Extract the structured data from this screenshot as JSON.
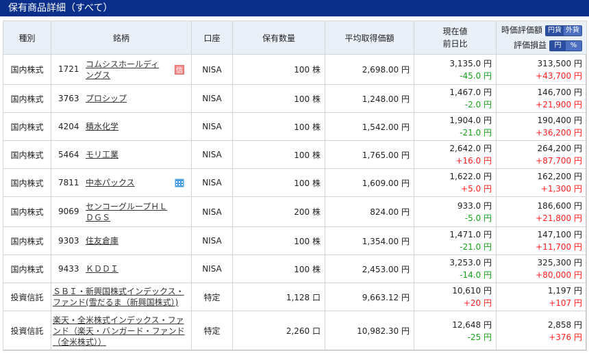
{
  "title": "保有商品詳細（すべて）",
  "headers": {
    "type": "種別",
    "name": "銘柄",
    "account": "口座",
    "quantity": "保有数量",
    "avg_price": "平均取得価額",
    "price_line1": "現在値",
    "price_line2": "前日比",
    "value_line1": "時価評価額",
    "value_toggle": [
      "円貨",
      "外貨"
    ],
    "pl_line": "評価損益",
    "pl_toggle": [
      "円",
      "%"
    ]
  },
  "rows": [
    {
      "type": "国内株式",
      "code": "1721",
      "name": "コムシスホールディングス",
      "icon": "credit-icon",
      "account": "NISA",
      "qty": "100 株",
      "avg": "2,698.00 円",
      "price": "3,135.0 円",
      "change": "-45.0 円",
      "value": "313,500 円",
      "pl": "+43,700 円"
    },
    {
      "type": "国内株式",
      "code": "3763",
      "name": "プロシップ",
      "icon": "",
      "account": "NISA",
      "qty": "100 株",
      "avg": "1,248.00 円",
      "price": "1,467.0 円",
      "change": "-2.0 円",
      "value": "146,700 円",
      "pl": "+21,900 円"
    },
    {
      "type": "国内株式",
      "code": "4204",
      "name": "積水化学",
      "icon": "",
      "account": "NISA",
      "qty": "100 株",
      "avg": "1,542.00 円",
      "price": "1,904.0 円",
      "change": "-21.0 円",
      "value": "190,400 円",
      "pl": "+36,200 円"
    },
    {
      "type": "国内株式",
      "code": "5464",
      "name": "モリ工業",
      "icon": "",
      "account": "NISA",
      "qty": "100 株",
      "avg": "1,765.00 円",
      "price": "2,642.0 円",
      "change": "+16.0 円",
      "value": "264,200 円",
      "pl": "+87,700 円"
    },
    {
      "type": "国内株式",
      "code": "7811",
      "name": "中本パックス",
      "icon": "calendar-icon",
      "account": "NISA",
      "qty": "100 株",
      "avg": "1,609.00 円",
      "price": "1,622.0 円",
      "change": "+5.0 円",
      "value": "162,200 円",
      "pl": "+1,300 円"
    },
    {
      "type": "国内株式",
      "code": "9069",
      "name": "センコーグループＨＬＤＧＳ",
      "icon": "",
      "account": "NISA",
      "qty": "200 株",
      "avg": "824.00 円",
      "price": "933.0 円",
      "change": "-5.0 円",
      "value": "186,600 円",
      "pl": "+21,800 円"
    },
    {
      "type": "国内株式",
      "code": "9303",
      "name": "住友倉庫",
      "icon": "",
      "account": "NISA",
      "qty": "100 株",
      "avg": "1,354.00 円",
      "price": "1,471.0 円",
      "change": "-21.0 円",
      "value": "147,100 円",
      "pl": "+11,700 円"
    },
    {
      "type": "国内株式",
      "code": "9433",
      "name": "ＫＤＤＩ",
      "icon": "",
      "account": "NISA",
      "qty": "100 株",
      "avg": "2,453.00 円",
      "price": "3,253.0 円",
      "change": "-14.0 円",
      "value": "325,300 円",
      "pl": "+80,000 円"
    },
    {
      "type": "投資信託",
      "code": "",
      "name": "ＳＢＩ・新興国株式インデックス・ファンド(雪だるま（新興国株式）)",
      "icon": "",
      "account": "特定",
      "qty": "1,128 口",
      "avg": "9,663.12 円",
      "price": "10,610 円",
      "change": "+20 円",
      "value": "1,197 円",
      "pl": "+107 円"
    },
    {
      "type": "投資信託",
      "code": "",
      "name": "楽天・全米株式インデックス・ファンド（楽天・バンガード・ファンド（全米株式））",
      "icon": "",
      "account": "特定",
      "qty": "2,260 口",
      "avg": "10,982.30 円",
      "price": "12,648 円",
      "change": "-25 円",
      "value": "2,858 円",
      "pl": "+376 円"
    }
  ],
  "colors": {
    "header_bar": "#0a2f8a",
    "header_cell": "#eaf0f8",
    "positive": "#ff1e1e",
    "negative": "#17a317"
  }
}
